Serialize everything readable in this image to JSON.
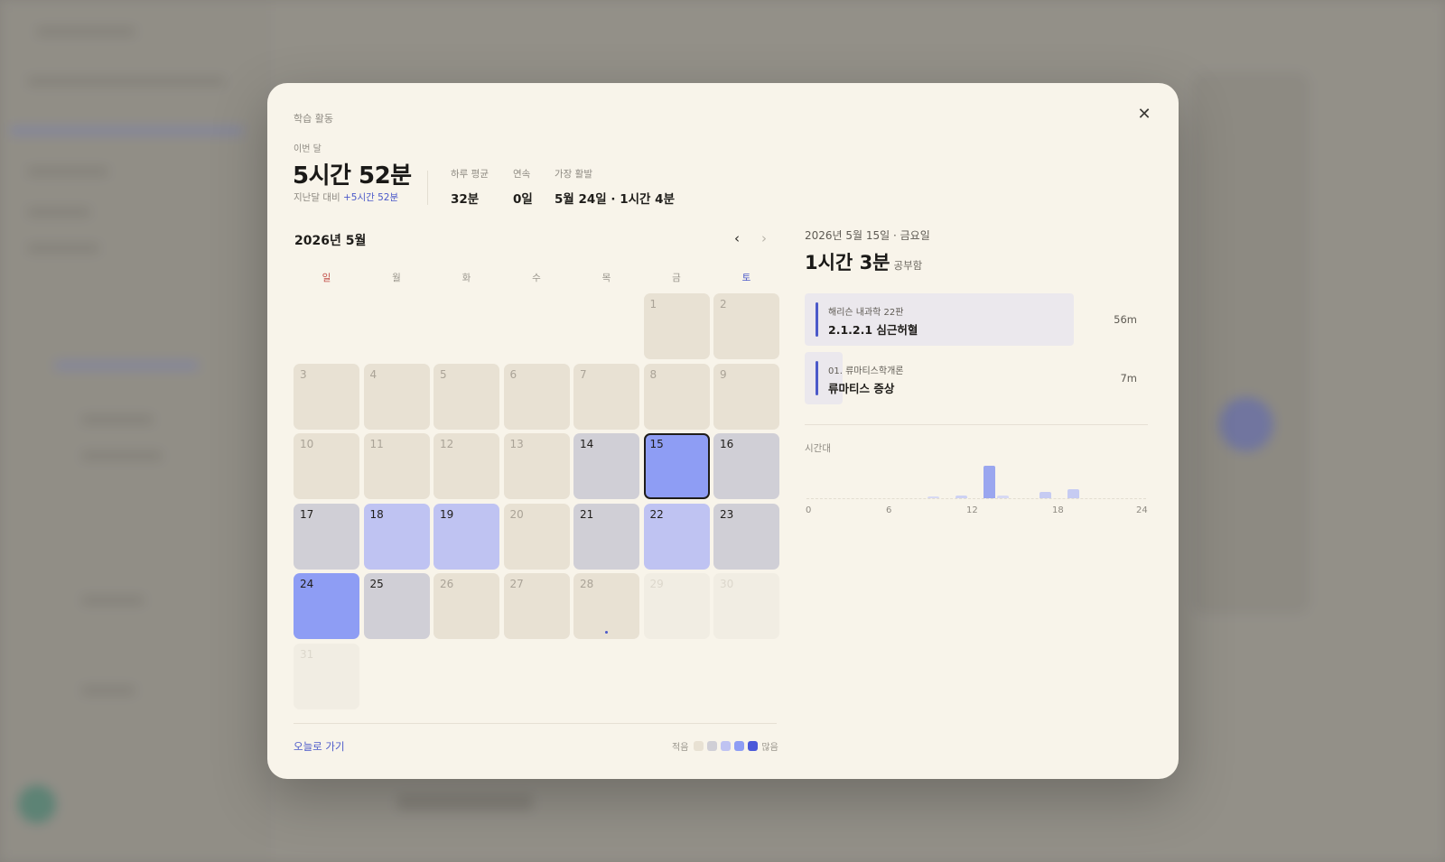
{
  "modal": {
    "title": "학습 활동",
    "close_icon": "close-icon"
  },
  "summary": {
    "month_label": "이번 달",
    "total": "5시간 52분",
    "compare_prefix": "지난달 대비",
    "compare_delta": "+5시간 52분",
    "stats": [
      {
        "label": "하루 평균",
        "value": "32분"
      },
      {
        "label": "연속",
        "value": "0일"
      },
      {
        "label": "가장 활발",
        "value": "5월 24일 · 1시간 4분"
      }
    ]
  },
  "calendar": {
    "title": "2026년 5월",
    "prev_icon": "chevron-left-icon",
    "next_icon": "chevron-right-icon",
    "weekdays": [
      "일",
      "월",
      "화",
      "수",
      "목",
      "금",
      "토"
    ],
    "leading_blank_days": 5,
    "selected_day": "15",
    "days": [
      {
        "n": "1",
        "level": 0
      },
      {
        "n": "2",
        "level": 0
      },
      {
        "n": "3",
        "level": 0
      },
      {
        "n": "4",
        "level": 0
      },
      {
        "n": "5",
        "level": 0
      },
      {
        "n": "6",
        "level": 0
      },
      {
        "n": "7",
        "level": 0
      },
      {
        "n": "8",
        "level": 0
      },
      {
        "n": "9",
        "level": 0
      },
      {
        "n": "10",
        "level": 0
      },
      {
        "n": "11",
        "level": 0
      },
      {
        "n": "12",
        "level": 0
      },
      {
        "n": "13",
        "level": 0
      },
      {
        "n": "14",
        "level": 1
      },
      {
        "n": "15",
        "level": 3
      },
      {
        "n": "16",
        "level": 1
      },
      {
        "n": "17",
        "level": 1
      },
      {
        "n": "18",
        "level": 2
      },
      {
        "n": "19",
        "level": 2
      },
      {
        "n": "20",
        "level": 0
      },
      {
        "n": "21",
        "level": 1
      },
      {
        "n": "22",
        "level": 2
      },
      {
        "n": "23",
        "level": 1
      },
      {
        "n": "24",
        "level": 3
      },
      {
        "n": "25",
        "level": 1
      },
      {
        "n": "26",
        "level": 0
      },
      {
        "n": "27",
        "level": 0
      },
      {
        "n": "28",
        "level": 0,
        "today": true
      },
      {
        "n": "29",
        "level": -1
      },
      {
        "n": "30",
        "level": -1
      },
      {
        "n": "31",
        "level": -1
      }
    ],
    "today_link": "오늘로 가기",
    "legend_low": "적음",
    "legend_high": "많음",
    "legend_colors": [
      "#e8e1d3",
      "#d0cfd6",
      "#bfc3f2",
      "#8e9df4",
      "#4b59d9"
    ]
  },
  "detail": {
    "date": "2026년 5월 15일 · 금요일",
    "duration": "1시간 3분",
    "duration_suffix": "공부함",
    "sessions": [
      {
        "book": "해리슨 내과학 22판",
        "chapter": "2.1.2.1 심근허혈",
        "duration": "56m",
        "fraction": 0.89
      },
      {
        "book": "01. 류마티스학개론",
        "chapter": "류마티스 증상",
        "duration": "7m",
        "fraction": 0.11
      }
    ],
    "timeline_label": "시간대",
    "hour_ticks": [
      "0",
      "6",
      "12",
      "18",
      "24"
    ]
  },
  "chart_data": {
    "type": "bar",
    "xlabel": "시간대",
    "xlim": [
      0,
      24
    ],
    "x": [
      9,
      11,
      13,
      14,
      17,
      19
    ],
    "values": [
      1,
      2,
      26,
      2,
      5,
      7
    ],
    "colors": [
      "#d7d9f3",
      "#cdd1f3",
      "#9aa6ef",
      "#d7d9f3",
      "#c6cbf2",
      "#c6cbf2"
    ]
  },
  "colors": {
    "accent": "#4b59c9",
    "level0": "#e8e1d3",
    "level1": "#d0cfd6",
    "level2": "#bfc3f2",
    "level3": "#8e9df4",
    "future": "#f1ede3"
  }
}
